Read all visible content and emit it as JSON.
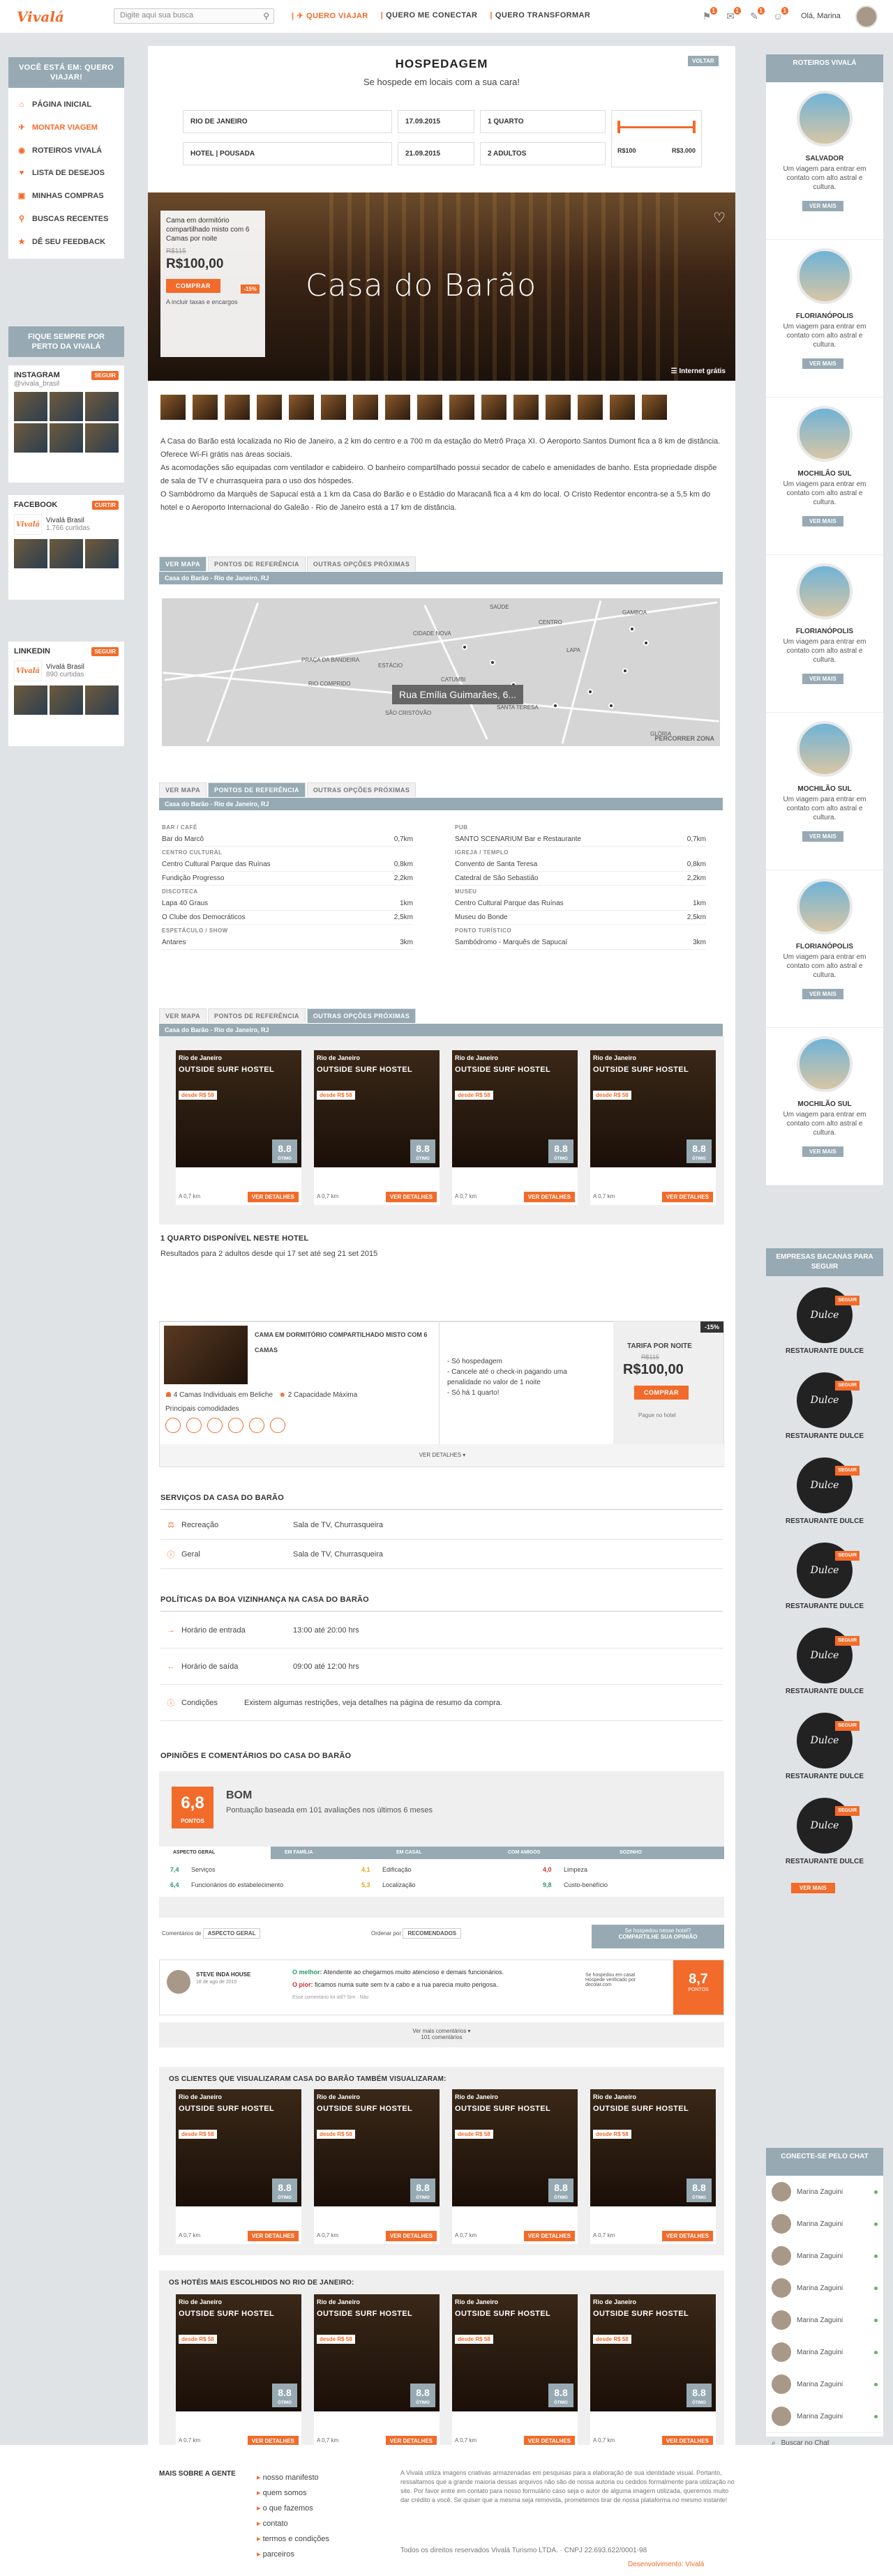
{
  "topbar": {
    "logo": "Vivalá",
    "search_placeholder": "Digite aqui sua busca",
    "nav": [
      "QUERO VIAJAR",
      "QUERO ME CONECTAR",
      "QUERO TRANSFORMAR"
    ],
    "badges": [
      "1",
      "1",
      "1",
      "1"
    ],
    "greeting": "Olá, Marina"
  },
  "left": {
    "title": "VOCÊ ESTÁ EM: QUERO VIAJAR!",
    "menu": [
      "PÁGINA INICIAL",
      "MONTAR VIAGEM",
      "ROTEIROS VIVALÁ",
      "LISTA DE DESEJOS",
      "MINHAS COMPRAS",
      "BUSCAS RECENTES",
      "DÊ SEU FEEDBACK"
    ],
    "follow": "FIQUE SEMPRE POR PERTO DA VIVALÁ",
    "instagram": "INSTAGRAM",
    "insta_handle": "@vivala_brasil",
    "follow_btn": "SEGUIR",
    "facebook": "FACEBOOK",
    "curtir": "CURTIR",
    "fb_name": "Vivalá Brasil",
    "fb_likes": "1.766 curtidas",
    "linkedin": "LINKEDIN",
    "li_name": "Vivalá Brasil",
    "li_likes": "890 curtidas"
  },
  "main": {
    "title": "HOSPEDAGEM",
    "subtitle": "Se hospede em locais com a sua cara!",
    "voltar": "VOLTAR",
    "city": "RIO DE JANEIRO",
    "type": "HOTEL | POUSADA",
    "d1": "17.09.2015",
    "d2": "21.09.2015",
    "rooms": "1 QUARTO",
    "guests": "2 ADULTOS",
    "pmin": "R$100",
    "pmax": "R$3.000",
    "hero": {
      "title": "Casa do Barão",
      "room": "Cama em dormitório compartilhado misto com 6 Camas por noite",
      "old": "R$115",
      "pct": "-15%",
      "price": "R$100,00",
      "buy": "COMPRAR",
      "tax": "A incluir taxas e encargos",
      "wifi": "Internet grátis"
    },
    "desc": [
      "A Casa do Barão está localizada no Rio de Janeiro, a 2 km do centro e a 700 m da estação do Metrô Praça XI. O Aeroporto Santos Dumont fica a 8 km de distância. Oferece Wi-Fi grátis nas áreas sociais.",
      "As acomodações são equipadas com ventilador e cabideiro. O banheiro compartilhado possui secador de cabelo e amenidades de banho. Esta propriedade dispõe de sala de TV e churrasqueira para o uso dos hóspedes.",
      "O Sambódromo da Marquês de Sapucaí está a 1 km da Casa do Barão e o Estádio do Maracanã fica a 4 km do local. O Cristo Redentor encontra-se a 5,5 km do hotel e o Aeroporto Internacional do Galeão - Rio de Janeiro está a 17 km de distância."
    ],
    "tabs": [
      "VER MAPA",
      "PONTOS DE REFERÊNCIA",
      "OUTRAS OPÇÕES PRÓXIMAS"
    ],
    "place": "Casa do Barão - Rio de Janeiro, RJ",
    "map_callout": "Rua Emília Guimarães, 6...",
    "map_link": "PERCORRER ZONA",
    "map_labels": [
      "CIDADE NOVA",
      "CENTRO",
      "PRAÇA DA BANDEIRA",
      "ESTÁCIO",
      "RIO COMPRIDO",
      "CATUMBI",
      "SANTA TERESA",
      "SÃO CRISTÓVÃO",
      "LAPA",
      "GLÓRIA",
      "SAÚDE",
      "GAMBOA"
    ],
    "refs_left": [
      {
        "cat": "BAR / CAFÉ",
        "items": [
          [
            "Bar do Marcô",
            "0,7km"
          ]
        ]
      },
      {
        "cat": "CENTRO CULTURAL",
        "items": [
          [
            "Centro Cultural Parque das Ruínas",
            "0,8km"
          ],
          [
            "Fundição Progresso",
            "2,2km"
          ]
        ]
      },
      {
        "cat": "DISCOTECA",
        "items": [
          [
            "Lapa 40 Graus",
            "1km"
          ],
          [
            "O Clube dos Democráticos",
            "2,5km"
          ]
        ]
      },
      {
        "cat": "ESPETÁCULO / SHOW",
        "items": [
          [
            "Antares",
            "3km"
          ]
        ]
      }
    ],
    "refs_right": [
      {
        "cat": "PUB",
        "items": [
          [
            "SANTO SCENARIUM Bar e Restaurante",
            "0,7km"
          ]
        ]
      },
      {
        "cat": "IGREJA / TEMPLO",
        "items": [
          [
            "Convento de Santa Teresa",
            "0,8km"
          ],
          [
            "Catedral de São Sebastião",
            "2,2km"
          ]
        ]
      },
      {
        "cat": "MUSEU",
        "items": [
          [
            "Centro Cultural Parque das Ruínas",
            "1km"
          ],
          [
            "Museu do Bonde",
            "2,5km"
          ]
        ]
      },
      {
        "cat": "PONTO TURÍSTICO",
        "items": [
          [
            "Sambódromo - Marquês de Sapucaí",
            "3km"
          ]
        ]
      }
    ],
    "hcard": {
      "city": "Rio de Janeiro",
      "name": "OUTSIDE SURF HOSTEL",
      "price": "desde R$ 58",
      "score": "8.8",
      "score_lbl": "ÓTIMO",
      "dist": "A 0,7 km",
      "btn": "VER DETALHES"
    },
    "room_sec": "1 QUARTO DISPONÍVEL NESTE HOTEL",
    "room_sub": "Resultados para 2 adultos desde qui 17 set até seg 21 set 2015",
    "room_name": "CAMA EM DORMITÓRIO COMPARTILHADO MISTO COM 6 CAMAS",
    "room_f1": "4 Camas Individuais em Beliche",
    "room_f2": "2 Capacidade Máxima",
    "room_am": "Principais comodidades",
    "room_pol": [
      "- Só hospedagem",
      "- Cancele até o check-in pagando uma penalidade no valor de 1 noite",
      "- Só há 1 quarto!"
    ],
    "tarifa": "TARIFA POR NOITE",
    "r_old": "R$115",
    "r_pct": "-15%",
    "r_price": "R$100,00",
    "r_buy": "COMPRAR",
    "r_pay": "Pague no hotel",
    "r_more": "VER DETALHES",
    "serv_title": "SERVIÇOS DA CASA DO BARÃO",
    "serv": [
      [
        "Recreação",
        "Sala de TV, Churrasqueira"
      ],
      [
        "Geral",
        "Sala de TV, Churrasqueira"
      ]
    ],
    "pol_title": "POLÍTICAS DA BOA VIZINHANÇA NA CASA DO BARÃO",
    "pol": [
      [
        "Horário de entrada",
        "13:00 até 20:00 hrs"
      ],
      [
        "Horário de saída",
        "09:00 até 12:00 hrs"
      ],
      [
        "Condições",
        "Existem algumas restrições, veja detalhes na página de resumo da compra."
      ]
    ],
    "op_title": "OPINIÕES E COMENTÁRIOS DO CASA DO BARÃO",
    "score": "6,8",
    "score_lbl": "PONTOS",
    "rating": "BOM",
    "rating_sub": "Pontuação baseada em 101 avaliações nos últimos 6 meses",
    "score_tabs": [
      "ASPECTO GERAL",
      "EM FAMÍLIA",
      "EM CASAL",
      "COM AMIGOS",
      "SOZINHO"
    ],
    "scores": [
      [
        "7,4",
        "Serviços"
      ],
      [
        "6,4",
        "Funcionários do estabelecimento"
      ],
      [
        "4,1",
        "Edificação"
      ],
      [
        "5,3",
        "Localização"
      ],
      [
        "4,0",
        "Limpeza"
      ],
      [
        "9,8",
        "Custo-benefício"
      ]
    ],
    "comment_by": "Comentários de",
    "comment_sel": "ASPECTO GERAL",
    "ordenar": "Ordenar por",
    "ord_sel": "RECOMENDADOS",
    "hospedou": "Se hospedou nesse hotel?",
    "compart": "COMPARTILHE SUA OPINIÃO",
    "c_user": "STEVE INDA HOUSE",
    "c_date": "18 de ago de 2015",
    "c_best": "O melhor:",
    "c_best_t": "Atendente ao chegarmos muito atencioso e demais funcionários.",
    "c_worst": "O pior:",
    "c_worst_t": "ficamos numa suite sem tv a cabo e a rua parecia muito perigosa.",
    "c_useful": "Esse comentário foi útil?  Sim · Não",
    "c_verified": "Se hospedou em casal",
    "c_verified2": "Hóspede verificado por decolar.com",
    "c_score": "8,7",
    "c_score_lbl": "PONTOS",
    "more_c": "Ver mais comentários",
    "more_c2": "101 comentários",
    "also": "OS CLIENTES QUE VISUALIZARAM CASA DO BARÃO TAMBÉM VISUALIZARAM:",
    "chosen": "OS HOTÉIS MAIS ESCOLHIDOS NO RIO DE JANEIRO:"
  },
  "right": {
    "title": "ROTEIROS VIVALÁ",
    "items": [
      {
        "name": "SALVADOR"
      },
      {
        "name": "FLORIANÓPOLIS"
      },
      {
        "name": "MOCHILÃO SUL"
      },
      {
        "name": "FLORIANÓPOLIS"
      },
      {
        "name": "MOCHILÃO SUL"
      },
      {
        "name": "FLORIANÓPOLIS"
      },
      {
        "name": "MOCHILÃO SUL"
      }
    ],
    "txt": "Um viagem para entrar em contato com alto astral e cultura.",
    "vm": "VER MAIS",
    "emp_title": "EMPRESAS BACANAS PARA SEGUIR",
    "emp_name": "RESTAURANTE DULCE",
    "emp_logo": "Dulce",
    "seguir": "SEGUIR",
    "chat_title": "CONECTE-SE PELO CHAT",
    "chat_user": "Marina Zaguini",
    "chat_search": "Buscar no Chat"
  },
  "footer": {
    "title": "MAIS SOBRE A GENTE",
    "links": [
      "nosso manifesto",
      "quem somos",
      "o que fazemos",
      "contato",
      "termos e condições",
      "parceiros"
    ],
    "legal": "A Vivalá utiliza imagens criativas armazenadas em pesquisas para a elaboração de sua identidade visual. Portanto, ressaltamos que a grande maioria dessas arquivos não são de nossa autoria ou cedidos formalmente para utilização no site. Por favor entre em contato para nosso formulário caso seja o autor de alguma imagem utilizada, queremos muito dar crédito a você. Se quiser que a mesma seja removida, prometemos tirar de nossa plataforma no mesmo instante!",
    "rights": "Todos os direitos reservados Vivalá Turismo LTDA. · CNPJ 22.693.622/0001-98",
    "dev": "Desenvolvimento: Vivalá"
  }
}
